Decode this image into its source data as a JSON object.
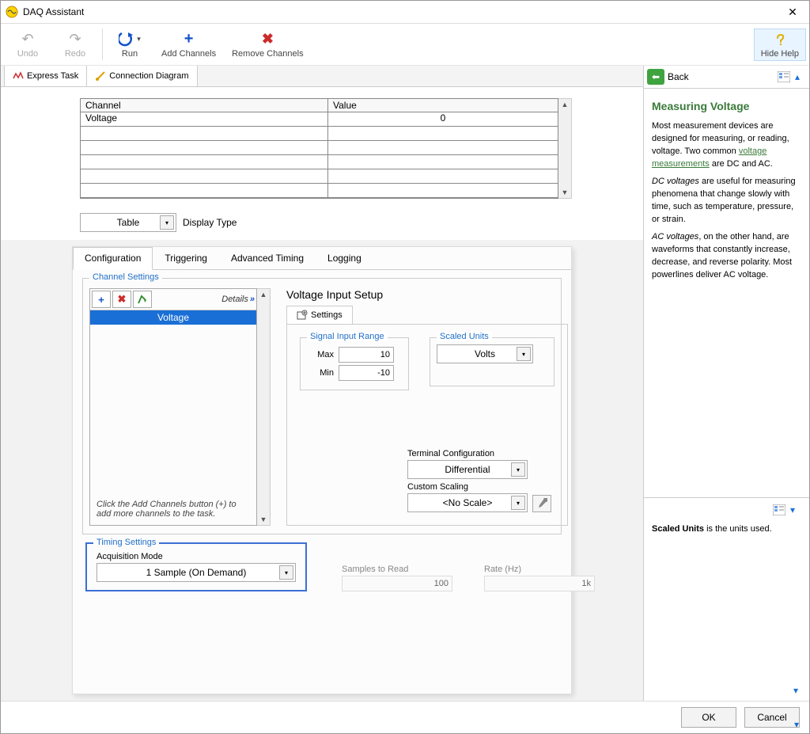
{
  "window": {
    "title": "DAQ Assistant"
  },
  "toolbar": {
    "undo": "Undo",
    "redo": "Redo",
    "run": "Run",
    "add": "Add Channels",
    "remove": "Remove Channels",
    "hide_help": "Hide Help"
  },
  "main_tabs": {
    "express": "Express Task",
    "connection": "Connection Diagram"
  },
  "data_table": {
    "headers": {
      "channel": "Channel",
      "value": "Value"
    },
    "rows": [
      {
        "channel": "Voltage",
        "value": "0"
      }
    ]
  },
  "display_type": {
    "label": "Display Type",
    "value": "Table"
  },
  "config_tabs": {
    "configuration": "Configuration",
    "triggering": "Triggering",
    "advanced": "Advanced Timing",
    "logging": "Logging"
  },
  "channel_settings": {
    "legend": "Channel Settings",
    "details": "Details",
    "selected": "Voltage",
    "hint": "Click the Add Channels button (+) to add more channels to the task."
  },
  "voltage_setup": {
    "title": "Voltage Input Setup",
    "settings_tab": "Settings",
    "signal_range": {
      "legend": "Signal Input Range",
      "max_label": "Max",
      "max": "10",
      "min_label": "Min",
      "min": "-10"
    },
    "scaled_units": {
      "legend": "Scaled Units",
      "value": "Volts"
    },
    "terminal_config": {
      "label": "Terminal Configuration",
      "value": "Differential"
    },
    "custom_scaling": {
      "label": "Custom Scaling",
      "value": "<No Scale>"
    }
  },
  "timing": {
    "legend": "Timing Settings",
    "acq_mode": {
      "label": "Acquisition Mode",
      "value": "1 Sample (On Demand)"
    },
    "samples": {
      "label": "Samples to Read",
      "value": "100"
    },
    "rate": {
      "label": "Rate (Hz)",
      "value": "1k"
    }
  },
  "footer": {
    "ok": "OK",
    "cancel": "Cancel"
  },
  "help": {
    "back": "Back",
    "title": "Measuring Voltage",
    "p1a": "Most measurement devices are designed for measuring, or reading, voltage. Two common ",
    "link": "voltage measurements",
    "p1b": " are DC and AC.",
    "p2a": "DC voltages",
    "p2b": " are useful for measuring phenomena that change slowly with time, such as temperature, pressure, or strain.",
    "p3a": "AC voltages",
    "p3b": ", on the other hand, are waveforms that constantly increase, decrease, and reverse polarity. Most powerlines deliver AC voltage."
  },
  "lower_help": {
    "text_a": "Scaled Units",
    "text_b": " is the units used."
  }
}
